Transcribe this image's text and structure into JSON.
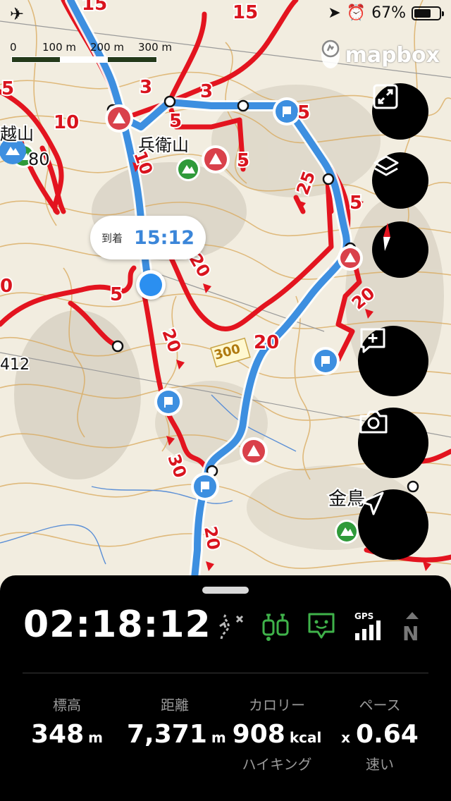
{
  "status_bar": {
    "airplane_icon": "airplane-icon",
    "location_icon": "location-arrow-icon",
    "alarm_icon": "alarm-icon",
    "battery_percent": "67%",
    "battery_level": 0.67
  },
  "map": {
    "scale_labels": [
      "0",
      "100 m",
      "200 m",
      "300 m"
    ],
    "attribution": "mapbox",
    "elevation_label_left": "412",
    "place_labels": [
      "越山",
      "80",
      "兵衛山",
      "金鳥"
    ],
    "road_label": "300",
    "trail_numbers": [
      "15",
      "15",
      "3",
      "3",
      "5",
      "5",
      "10",
      "10",
      "5",
      "25",
      "5",
      "5",
      "20",
      "20",
      "20",
      "20",
      "30",
      "20",
      "5",
      "0"
    ],
    "arrival": {
      "label": "到着",
      "time": "15:12"
    }
  },
  "map_buttons": [
    {
      "name": "layout-button",
      "icon": "frame-icon"
    },
    {
      "name": "layers-button",
      "icon": "layers-icon"
    },
    {
      "name": "compass-button",
      "icon": "compass-icon"
    },
    {
      "name": "add-note-button",
      "icon": "add-note-icon"
    },
    {
      "name": "camera-button",
      "icon": "camera-icon"
    },
    {
      "name": "navigate-button",
      "icon": "navigation-arrow-icon"
    }
  ],
  "panel": {
    "elapsed_time": "02:18:12",
    "status_icons": [
      "route-off-icon",
      "hikers-icon",
      "chat-icon",
      "gps-signal-icon",
      "north-icon"
    ],
    "gps_label": "GPS",
    "north_label": "N",
    "stats": {
      "elevation": {
        "label": "標高",
        "value": "348",
        "unit": "m"
      },
      "distance": {
        "label": "距離",
        "value": "7,371",
        "unit": "m"
      },
      "calories": {
        "label": "カロリー",
        "value": "908",
        "unit": "kcal",
        "sub": "ハイキング"
      },
      "pace": {
        "label": "ペース",
        "prefix": "x",
        "value": "0.64",
        "sub": "速い"
      }
    }
  },
  "colors": {
    "trail_red": "#e3141f",
    "route_blue": "#3d8fe0",
    "contour": "#d9a85a",
    "panel_bg": "#000000",
    "accent_green": "#2f9a3a",
    "location_blue": "#2b8ff0"
  }
}
